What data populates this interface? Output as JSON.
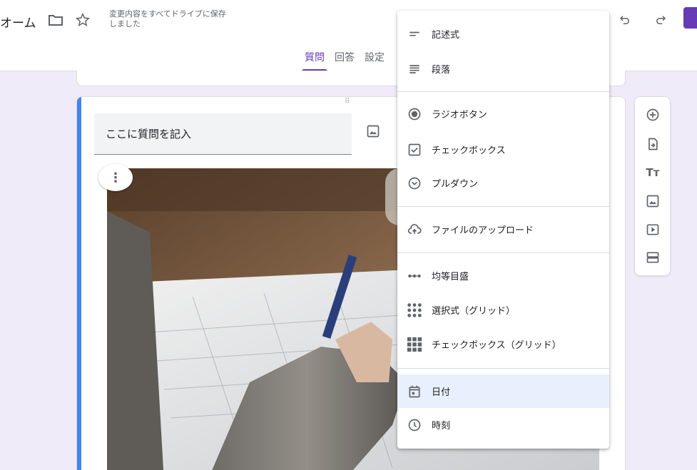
{
  "header": {
    "form_title": "オーム",
    "save_status": "変更内容をすべてドライブに保存しました",
    "tabs": [
      {
        "label": "質問",
        "active": true
      },
      {
        "label": "回答",
        "active": false
      },
      {
        "label": "設定",
        "active": false
      }
    ]
  },
  "question": {
    "placeholder": "ここに質問を記入"
  },
  "menu": {
    "items": [
      {
        "label": "記述式",
        "icon": "short-answer-icon"
      },
      {
        "label": "段落",
        "icon": "paragraph-icon"
      },
      {
        "label": "ラジオボタン",
        "icon": "radio-button-icon"
      },
      {
        "label": "チェックボックス",
        "icon": "checkbox-icon"
      },
      {
        "label": "プルダウン",
        "icon": "dropdown-icon"
      },
      {
        "label": "ファイルのアップロード",
        "icon": "cloud-upload-icon"
      },
      {
        "label": "均等目盛",
        "icon": "linear-scale-icon"
      },
      {
        "label": "選択式（グリッド）",
        "icon": "multiple-choice-grid-icon"
      },
      {
        "label": "チェックボックス（グリッド）",
        "icon": "checkbox-grid-icon"
      },
      {
        "label": "日付",
        "icon": "calendar-icon",
        "selected": true
      },
      {
        "label": "時刻",
        "icon": "clock-icon"
      }
    ]
  },
  "colors": {
    "accent": "#673ab7",
    "card_accent": "#4285f4",
    "background": "#f0ebf8",
    "selected_item": "#e8f0fe"
  }
}
